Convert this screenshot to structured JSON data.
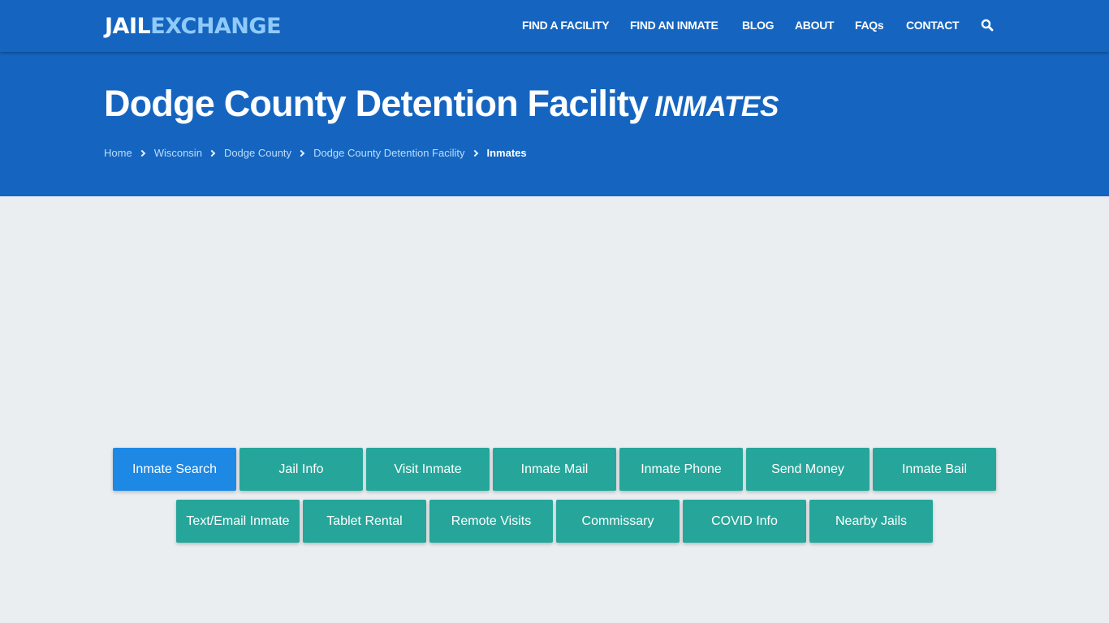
{
  "brand": {
    "part1": "JAIL",
    "part2": "EXCHANGE"
  },
  "nav": {
    "items": [
      {
        "label": "FIND A FACILITY"
      },
      {
        "label": "FIND AN INMATE"
      },
      {
        "label": "BLOG"
      },
      {
        "label": "ABOUT"
      },
      {
        "label": "FAQs"
      },
      {
        "label": "CONTACT"
      }
    ],
    "search_icon": "search-icon"
  },
  "hero": {
    "title": "Dodge County Detention Facility",
    "subtitle": "INMATES"
  },
  "breadcrumb": [
    {
      "label": "Home"
    },
    {
      "label": "Wisconsin"
    },
    {
      "label": "Dodge County"
    },
    {
      "label": "Dodge County Detention Facility"
    },
    {
      "label": "Inmates"
    }
  ],
  "buttons": {
    "row1": [
      {
        "label": "Inmate Search",
        "active": true
      },
      {
        "label": "Jail Info"
      },
      {
        "label": "Visit Inmate"
      },
      {
        "label": "Inmate Mail"
      },
      {
        "label": "Inmate Phone"
      },
      {
        "label": "Send Money"
      },
      {
        "label": "Inmate Bail"
      }
    ],
    "row2": [
      {
        "label": "Text/Email Inmate"
      },
      {
        "label": "Tablet Rental"
      },
      {
        "label": "Remote Visits"
      },
      {
        "label": "Commissary"
      },
      {
        "label": "COVID Info"
      },
      {
        "label": "Nearby Jails"
      }
    ]
  },
  "colors": {
    "brand_blue": "#1565c0",
    "logo_accent": "#90caf9",
    "active_button": "#1e88e5",
    "button_teal": "#26a69a",
    "page_background": "#ebeef1"
  }
}
